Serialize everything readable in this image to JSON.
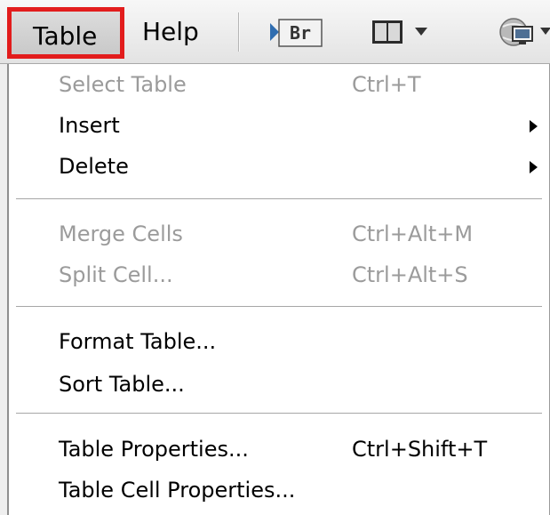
{
  "menubar": {
    "table_label": "Table",
    "help_label": "Help",
    "bridge_icon_text": "Br"
  },
  "menu": {
    "items": [
      {
        "label": "Select Table",
        "shortcut": "Ctrl+T",
        "enabled": false
      },
      {
        "label": "Insert",
        "shortcut": "",
        "enabled": true,
        "submenu": true
      },
      {
        "label": "Delete",
        "shortcut": "",
        "enabled": true,
        "submenu": true
      },
      {
        "label": "Merge Cells",
        "shortcut": "Ctrl+Alt+M",
        "enabled": false
      },
      {
        "label": "Split Cell...",
        "shortcut": "Ctrl+Alt+S",
        "enabled": false
      },
      {
        "label": "Format Table...",
        "shortcut": "",
        "enabled": true
      },
      {
        "label": "Sort Table...",
        "shortcut": "",
        "enabled": true
      },
      {
        "label": "Table Properties...",
        "shortcut": "Ctrl+Shift+T",
        "enabled": true
      },
      {
        "label": "Table Cell Properties...",
        "shortcut": "",
        "enabled": true
      }
    ]
  },
  "colors": {
    "highlight_border": "#e21c1c",
    "disabled_text": "#9b9b9b"
  }
}
